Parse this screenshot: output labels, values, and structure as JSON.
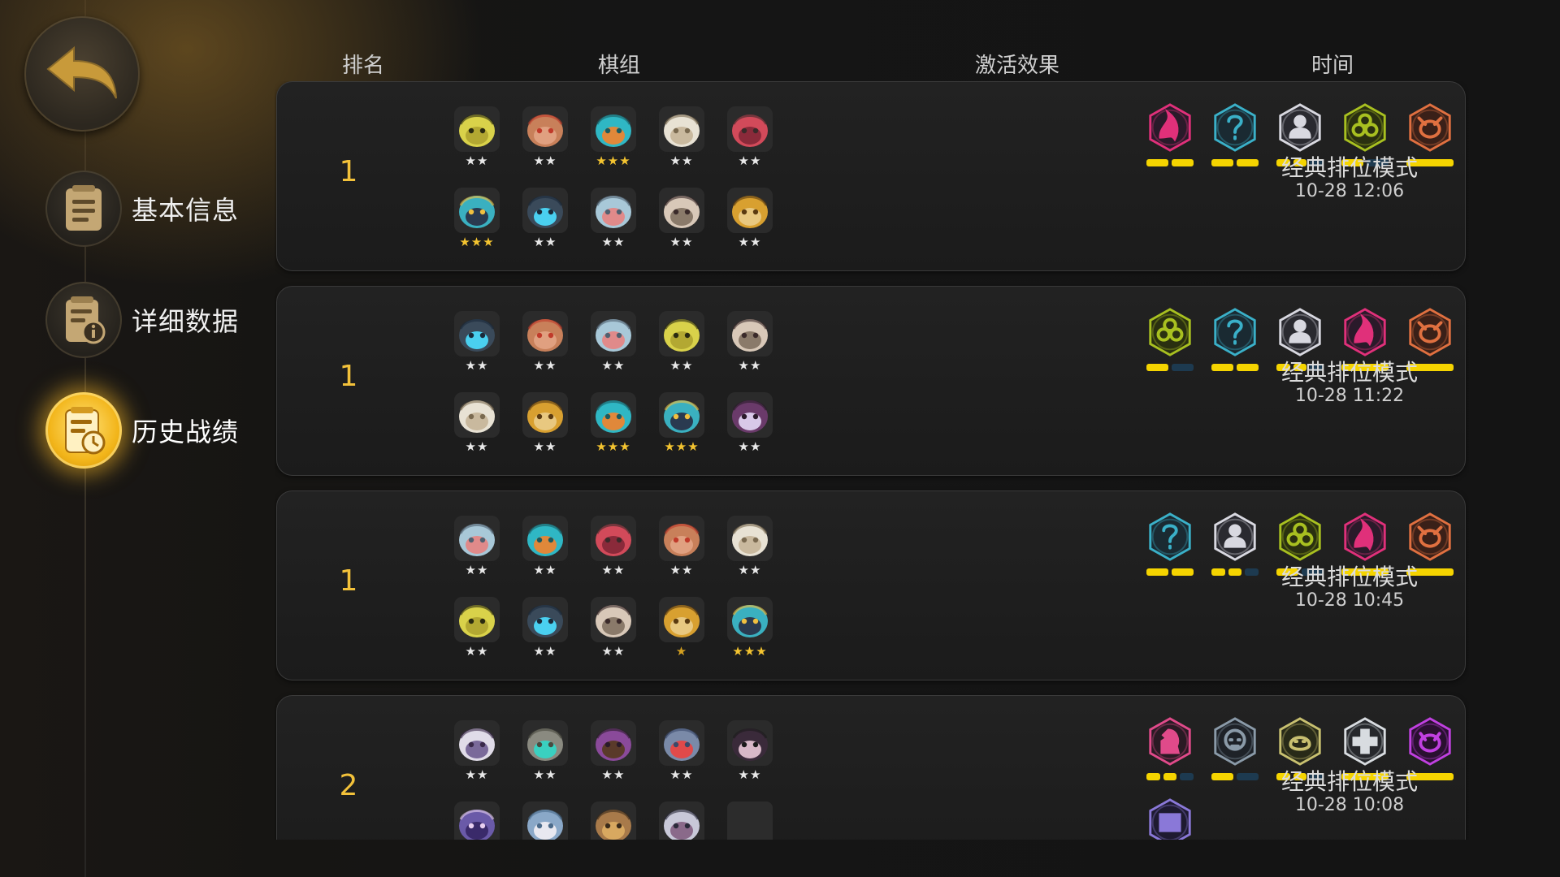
{
  "nav": {
    "back_icon": "back-arrow-icon",
    "items": [
      {
        "label": "基本信息",
        "icon": "document-icon",
        "active": false
      },
      {
        "label": "详细数据",
        "icon": "document-info-icon",
        "active": false
      },
      {
        "label": "历史战绩",
        "icon": "document-clock-icon",
        "active": true
      }
    ]
  },
  "columns": {
    "rank": "排名",
    "lineup": "棋组",
    "effects": "激活效果",
    "time": "时间"
  },
  "colors": {
    "accent": "#f2c13a",
    "bar_on": "#f5d400",
    "bar_off": "#1d3a50"
  },
  "matches": [
    {
      "rank": "1",
      "mode": "经典排位模式",
      "time": "10-28 12:06",
      "pieces": [
        {
          "icon": "yellow-frog-hero-icon",
          "stars": "★★"
        },
        {
          "icon": "feather-warrior-hero-icon",
          "stars": "★★"
        },
        {
          "icon": "teal-helmet-hero-icon",
          "stars": "★★★"
        },
        {
          "icon": "bearded-elder-hero-icon",
          "stars": "★★"
        },
        {
          "icon": "red-demon-hero-icon",
          "stars": "★★"
        },
        {
          "icon": "crystal-knight-hero-icon",
          "stars": "★★★"
        },
        {
          "icon": "blue-gem-robot-hero-icon",
          "stars": "★★"
        },
        {
          "icon": "horned-beast-hero-icon",
          "stars": "★★"
        },
        {
          "icon": "skull-horns-hero-icon",
          "stars": "★★"
        },
        {
          "icon": "golden-hood-hero-icon",
          "stars": "★★"
        }
      ],
      "traits": [
        {
          "icon": "pink-flame-trait-icon",
          "active": 2,
          "total": 2
        },
        {
          "icon": "cyan-question-trait-icon",
          "active": 2,
          "total": 2
        },
        {
          "icon": "silver-bust-trait-icon",
          "active": 2,
          "total": 3
        },
        {
          "icon": "olive-trio-trait-icon",
          "active": 1,
          "total": 2
        },
        {
          "icon": "orange-viking-trait-icon",
          "active": 1,
          "total": 1
        }
      ]
    },
    {
      "rank": "1",
      "mode": "经典排位模式",
      "time": "10-28 11:22",
      "pieces": [
        {
          "icon": "blue-gem-robot-hero-icon",
          "stars": "★★"
        },
        {
          "icon": "feather-warrior-hero-icon",
          "stars": "★★"
        },
        {
          "icon": "horned-beast-hero-icon",
          "stars": "★★"
        },
        {
          "icon": "yellow-frog-hero-icon",
          "stars": "★★"
        },
        {
          "icon": "skull-horns-hero-icon",
          "stars": "★★"
        },
        {
          "icon": "bearded-elder-hero-icon",
          "stars": "★★"
        },
        {
          "icon": "golden-hood-hero-icon",
          "stars": "★★"
        },
        {
          "icon": "teal-helmet-hero-icon",
          "stars": "★★★"
        },
        {
          "icon": "crystal-knight-hero-icon",
          "stars": "★★★"
        },
        {
          "icon": "purple-mask-hero-icon",
          "stars": "★★"
        }
      ],
      "traits": [
        {
          "icon": "olive-trio-trait-icon",
          "active": 1,
          "total": 2
        },
        {
          "icon": "cyan-question-trait-icon",
          "active": 2,
          "total": 2
        },
        {
          "icon": "silver-bust-trait-icon",
          "active": 2,
          "total": 3
        },
        {
          "icon": "pink-flame-trait-icon",
          "active": 1,
          "total": 1
        },
        {
          "icon": "orange-viking-trait-icon",
          "active": 1,
          "total": 1
        }
      ]
    },
    {
      "rank": "1",
      "mode": "经典排位模式",
      "time": "10-28 10:45",
      "pieces": [
        {
          "icon": "horned-beast-hero-icon",
          "stars": "★★"
        },
        {
          "icon": "teal-helmet-hero-icon",
          "stars": "★★"
        },
        {
          "icon": "red-demon-hero-icon",
          "stars": "★★"
        },
        {
          "icon": "feather-warrior-hero-icon",
          "stars": "★★"
        },
        {
          "icon": "bearded-elder-hero-icon",
          "stars": "★★"
        },
        {
          "icon": "yellow-frog-hero-icon",
          "stars": "★★"
        },
        {
          "icon": "blue-gem-robot-hero-icon",
          "stars": "★★"
        },
        {
          "icon": "skull-horns-hero-icon",
          "stars": "★★"
        },
        {
          "icon": "golden-hood-hero-icon",
          "stars": "★"
        },
        {
          "icon": "crystal-knight-hero-icon",
          "stars": "★★★"
        }
      ],
      "traits": [
        {
          "icon": "cyan-question-trait-icon",
          "active": 2,
          "total": 2
        },
        {
          "icon": "silver-bust-trait-icon",
          "active": 2,
          "total": 3
        },
        {
          "icon": "olive-trio-trait-icon",
          "active": 1,
          "total": 2
        },
        {
          "icon": "pink-flame-trait-icon",
          "active": 1,
          "total": 1
        },
        {
          "icon": "orange-viking-trait-icon",
          "active": 1,
          "total": 1
        }
      ]
    },
    {
      "rank": "2",
      "mode": "经典排位模式",
      "time": "10-28 10:08",
      "pieces": [
        {
          "icon": "white-hair-sage-hero-icon",
          "stars": "★★"
        },
        {
          "icon": "stone-golem-hero-icon",
          "stars": "★★"
        },
        {
          "icon": "purple-ogre-hero-icon",
          "stars": "★★"
        },
        {
          "icon": "red-eye-hunter-hero-icon",
          "stars": "★★"
        },
        {
          "icon": "dark-hair-assassin-hero-icon",
          "stars": "★★"
        },
        {
          "icon": "bat-wing-hero-icon",
          "stars": ""
        },
        {
          "icon": "walrus-hero-icon",
          "stars": ""
        },
        {
          "icon": "wood-mask-hero-icon",
          "stars": ""
        },
        {
          "icon": "silver-sage-hero-icon",
          "stars": ""
        },
        {
          "icon": "",
          "stars": ""
        }
      ],
      "traits": [
        {
          "icon": "pink-knight-trait-icon",
          "active": 2,
          "total": 3
        },
        {
          "icon": "grey-skull-trait-icon",
          "active": 1,
          "total": 2
        },
        {
          "icon": "olive-beast-trait-icon",
          "active": 2,
          "total": 3
        },
        {
          "icon": "grey-cross-trait-icon",
          "active": 1,
          "total": 1
        },
        {
          "icon": "purple-demon-trait-icon",
          "active": 1,
          "total": 1
        },
        {
          "icon": "violet-scroll-trait-icon",
          "active": 0,
          "total": 0
        }
      ]
    }
  ]
}
